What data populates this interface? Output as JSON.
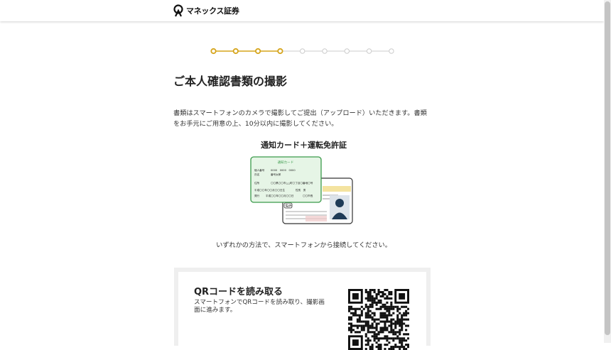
{
  "header": {
    "logo_text": "マネックス証券"
  },
  "progress": {
    "total_steps": 9,
    "completed_steps": 4,
    "active_color": "#d6a51c",
    "inactive_color": "#cccccc"
  },
  "page": {
    "title": "ご本人確認書類の撮影",
    "description": "書類はスマートフォンのカメラで撮影してご提出（アップロード）いただきます。書類をお手元にご用意の上、10分以内に撮影してください。",
    "document_title": "通知カード＋運転免許証",
    "method_text": "いずれかの方法で、スマートフォンから接続してください。"
  },
  "notification_card": {
    "title": "通知カード",
    "number_label": "個人番号",
    "number_value": "0000　0000　0000",
    "name_label": "氏名",
    "name_value": "番号太郎",
    "address_label": "住所",
    "address_value": "〇〇県〇〇市△△町〇丁目〇番地〇号",
    "birth_value": "平成〇〇年〇〇月〇〇日生",
    "gender_value": "性別　男",
    "issued_label": "発行",
    "issued_value": "平成〇〇年〇〇月〇〇日",
    "issuer_value": "〇〇市長"
  },
  "license": {
    "label": "免許"
  },
  "qr_section": {
    "title": "QRコードを読み取る",
    "description": "スマートフォンでQRコードを読み取り、撮影画面に進みます。"
  },
  "colors": {
    "accent": "#d6a51c",
    "card_green": "#e6f5e6",
    "card_border": "#3a9a4a",
    "license_photo": "#1f3b57"
  }
}
